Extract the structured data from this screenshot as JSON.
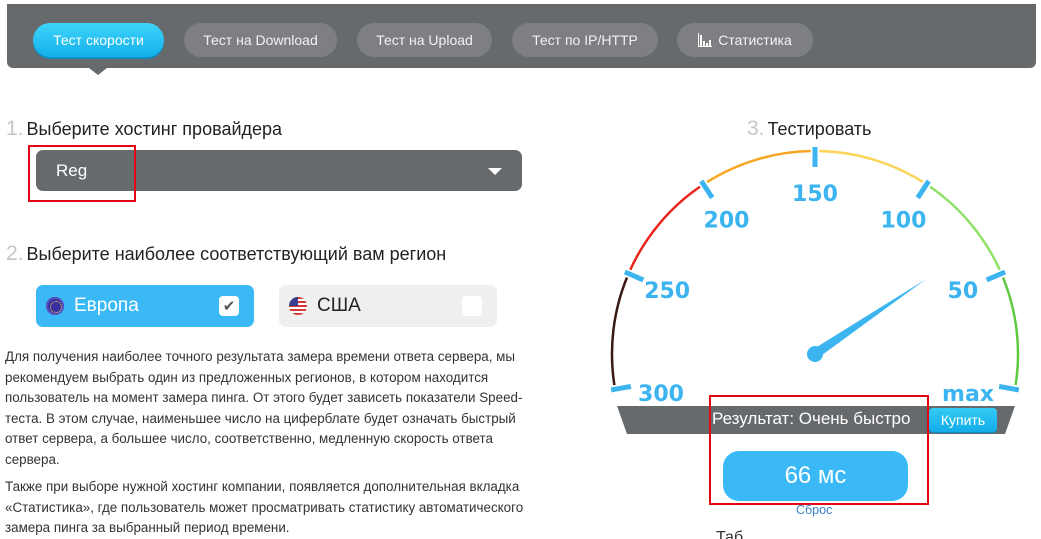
{
  "nav": {
    "tabs": [
      {
        "label": "Тест скорости",
        "active": true
      },
      {
        "label": "Тест на Download",
        "active": false
      },
      {
        "label": "Тест на Upload",
        "active": false
      },
      {
        "label": "Тест по IP/HTTP",
        "active": false
      },
      {
        "label": "Статистика",
        "active": false,
        "icon": "bar-chart-icon"
      }
    ]
  },
  "step1": {
    "number": "1.",
    "title": "Выберите хостинг провайдера",
    "select_value": "Reg"
  },
  "step2": {
    "number": "2.",
    "title": "Выберите наиболее соответствующий вам регион",
    "regions": [
      {
        "label": "Европа",
        "icon": "eu-flag-icon",
        "checked": true,
        "check_mark": "✔"
      },
      {
        "label": "США",
        "icon": "us-flag-icon",
        "checked": false,
        "check_mark": ""
      }
    ]
  },
  "description": {
    "paragraph1": "Для получения наиболее точного результата замера времени ответа сервера, мы рекомендуем выбрать один из предложенных регионов, в котором находится пользователь на момент замера пинга. От этого будет зависеть показатели Speed-теста. В этом случае, наименьшее число на циферблате будет означать быстрый ответ сервера, а большее число, соответственно, медленную скорость ответа сервера.",
    "paragraph2": "Также при выборе нужной хостинг компании, появляется дополнительная вкладка «Статистика», где пользователь может просматривать статистику автоматического замера пинга за выбранный период времени."
  },
  "step3": {
    "number": "3.",
    "title": "Тестировать"
  },
  "gauge": {
    "tick_labels": [
      "300",
      "250",
      "200",
      "150",
      "100",
      "50",
      "max"
    ],
    "tick_values": [
      300,
      250,
      200,
      150,
      100,
      50,
      0
    ],
    "needle_value_ms": 66,
    "arc_colors": {
      "300-250": "#3a1a12",
      "250-200": "#e8251b",
      "200-150": "#f6a623",
      "150-100": "#fcd45a",
      "100-50": "#8ee26a",
      "50-max": "#5fc93f"
    },
    "tick_color": "#3bb4ef"
  },
  "result": {
    "status_text": "Результат: Очень быстро",
    "buy_label": "Купить",
    "value_text": "66 мс",
    "reset_label": "Сброс"
  },
  "colors": {
    "accent": "#3bb9f6",
    "navbar": "#676a6d",
    "highlight": "#e30613"
  },
  "cut_off_text": "Таб"
}
